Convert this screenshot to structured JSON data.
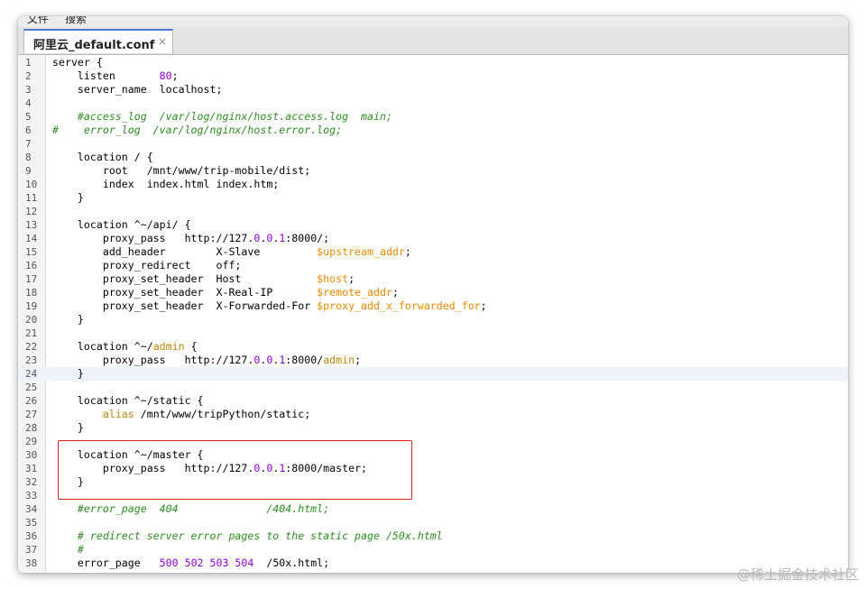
{
  "menubar": {
    "items": [
      "文件",
      "搜索"
    ]
  },
  "tab": {
    "title": "阿里云_default.conf",
    "close": "×"
  },
  "editor": {
    "current_line": 24,
    "highlighted_block": [
      30,
      32
    ],
    "lines": [
      {
        "n": "1",
        "t": [
          [
            "k",
            "server {"
          ]
        ]
      },
      {
        "n": "2",
        "t": [
          [
            "k",
            "    listen       "
          ],
          [
            "n",
            "80"
          ],
          [
            "k",
            ";"
          ]
        ]
      },
      {
        "n": "3",
        "t": [
          [
            "k",
            "    server_name  localhost;"
          ]
        ]
      },
      {
        "n": "4",
        "t": []
      },
      {
        "n": "5",
        "t": [
          [
            "c",
            "    #access_log  /var/log/nginx/host.access.log  main;"
          ]
        ]
      },
      {
        "n": "6",
        "t": [
          [
            "c",
            "#    error_log  /var/log/nginx/host.error.log;"
          ]
        ]
      },
      {
        "n": "7",
        "t": []
      },
      {
        "n": "8",
        "t": [
          [
            "k",
            "    location / {"
          ]
        ]
      },
      {
        "n": "9",
        "t": [
          [
            "k",
            "        root   /mnt/www/trip-mobile/dist;"
          ]
        ]
      },
      {
        "n": "10",
        "t": [
          [
            "k",
            "        index  index.html index.htm;"
          ]
        ]
      },
      {
        "n": "11",
        "t": [
          [
            "k",
            "    }"
          ]
        ]
      },
      {
        "n": "12",
        "t": []
      },
      {
        "n": "13",
        "t": [
          [
            "k",
            "    location ^~/api/ {"
          ]
        ]
      },
      {
        "n": "14",
        "t": [
          [
            "k",
            "        proxy_pass   http://127."
          ],
          [
            "n",
            "0"
          ],
          [
            "k",
            "."
          ],
          [
            "n",
            "0"
          ],
          [
            "k",
            "."
          ],
          [
            "n",
            "1"
          ],
          [
            "k",
            ":8000/;"
          ]
        ]
      },
      {
        "n": "15",
        "t": [
          [
            "k",
            "        add_header        X-Slave         "
          ],
          [
            "v",
            "$upstream_addr"
          ],
          [
            "k",
            ";"
          ]
        ]
      },
      {
        "n": "16",
        "t": [
          [
            "k",
            "        proxy_redirect    off;"
          ]
        ]
      },
      {
        "n": "17",
        "t": [
          [
            "k",
            "        proxy_set_header  Host            "
          ],
          [
            "v",
            "$host"
          ],
          [
            "k",
            ";"
          ]
        ]
      },
      {
        "n": "18",
        "t": [
          [
            "k",
            "        proxy_set_header  X-Real-IP       "
          ],
          [
            "v",
            "$remote_addr"
          ],
          [
            "k",
            ";"
          ]
        ]
      },
      {
        "n": "19",
        "t": [
          [
            "k",
            "        proxy_set_header  X-Forwarded-For "
          ],
          [
            "v",
            "$proxy_add_x_forwarded_for"
          ],
          [
            "k",
            ";"
          ]
        ]
      },
      {
        "n": "20",
        "t": [
          [
            "k",
            "    }"
          ]
        ]
      },
      {
        "n": "21",
        "t": []
      },
      {
        "n": "22",
        "t": [
          [
            "k",
            "    location ^~/"
          ],
          [
            "a",
            "admin"
          ],
          [
            "k",
            " {"
          ]
        ]
      },
      {
        "n": "23",
        "t": [
          [
            "k",
            "        proxy_pass   http://127."
          ],
          [
            "n",
            "0"
          ],
          [
            "k",
            "."
          ],
          [
            "n",
            "0"
          ],
          [
            "k",
            "."
          ],
          [
            "n",
            "1"
          ],
          [
            "k",
            ":8000/"
          ],
          [
            "a",
            "admin"
          ],
          [
            "k",
            ";"
          ]
        ]
      },
      {
        "n": "24",
        "t": [
          [
            "k",
            "    }"
          ]
        ]
      },
      {
        "n": "25",
        "t": []
      },
      {
        "n": "26",
        "t": [
          [
            "k",
            "    location ^~/static {"
          ]
        ]
      },
      {
        "n": "27",
        "t": [
          [
            "k",
            "        "
          ],
          [
            "a",
            "alias"
          ],
          [
            "k",
            " /mnt/www/tripPython/static;"
          ]
        ]
      },
      {
        "n": "28",
        "t": [
          [
            "k",
            "    }"
          ]
        ]
      },
      {
        "n": "29",
        "t": []
      },
      {
        "n": "30",
        "t": [
          [
            "k",
            "    location ^~/master {"
          ]
        ]
      },
      {
        "n": "31",
        "t": [
          [
            "k",
            "        proxy_pass   http://127."
          ],
          [
            "n",
            "0"
          ],
          [
            "k",
            "."
          ],
          [
            "n",
            "0"
          ],
          [
            "k",
            "."
          ],
          [
            "n",
            "1"
          ],
          [
            "k",
            ":8000/master;"
          ]
        ]
      },
      {
        "n": "32",
        "t": [
          [
            "k",
            "    }"
          ]
        ]
      },
      {
        "n": "33",
        "t": []
      },
      {
        "n": "34",
        "t": [
          [
            "c",
            "    #error_page  404              /404.html;"
          ]
        ]
      },
      {
        "n": "35",
        "t": []
      },
      {
        "n": "36",
        "t": [
          [
            "c",
            "    # redirect server error pages to the static page /50x.html"
          ]
        ]
      },
      {
        "n": "37",
        "t": [
          [
            "c",
            "    #"
          ]
        ]
      },
      {
        "n": "38",
        "t": [
          [
            "k",
            "    error_page   "
          ],
          [
            "n",
            "500 502 503 504"
          ],
          [
            "k",
            "  /50x.html;"
          ]
        ]
      }
    ]
  },
  "watermark": "@稀土掘金技术社区"
}
